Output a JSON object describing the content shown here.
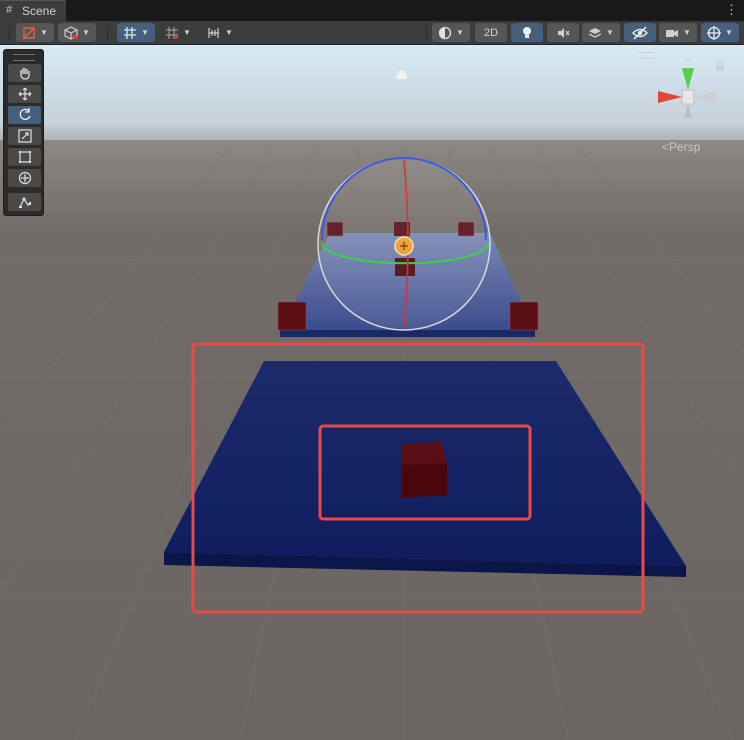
{
  "tab": {
    "label": "Scene",
    "icon": "grid-icon"
  },
  "toolbar": {
    "btn_2d_label": "2D",
    "tools": [
      "draw-mode-icon",
      "cube-icon",
      "snap-grid-icon",
      "grid-snap-increment-icon",
      "ruler-increment-icon",
      "shading-sphere-icon",
      "lighting-bulb-icon",
      "audio-mute-icon",
      "effects-layers-icon",
      "hidden-visibility-icon",
      "camera-icon",
      "gizmo-icon"
    ]
  },
  "scene_tools": [
    "hand-tool-icon",
    "move-tool-icon",
    "rotate-tool-icon",
    "scale-tool-icon",
    "rect-tool-icon",
    "transform-tool-icon",
    "custom-tool-icon"
  ],
  "active_tool": "rotate-tool-icon",
  "view_label": "Persp",
  "colors": {
    "ground": "#6e6865",
    "sky": "#d2e6f2",
    "platform": "#1b2a6e",
    "platform_edge": "#0e1a4a",
    "cube": "#4a0a0f",
    "highlight": "#e84a4a",
    "toolbar_bg": "#3c3c3c",
    "button_active": "#46607c"
  }
}
